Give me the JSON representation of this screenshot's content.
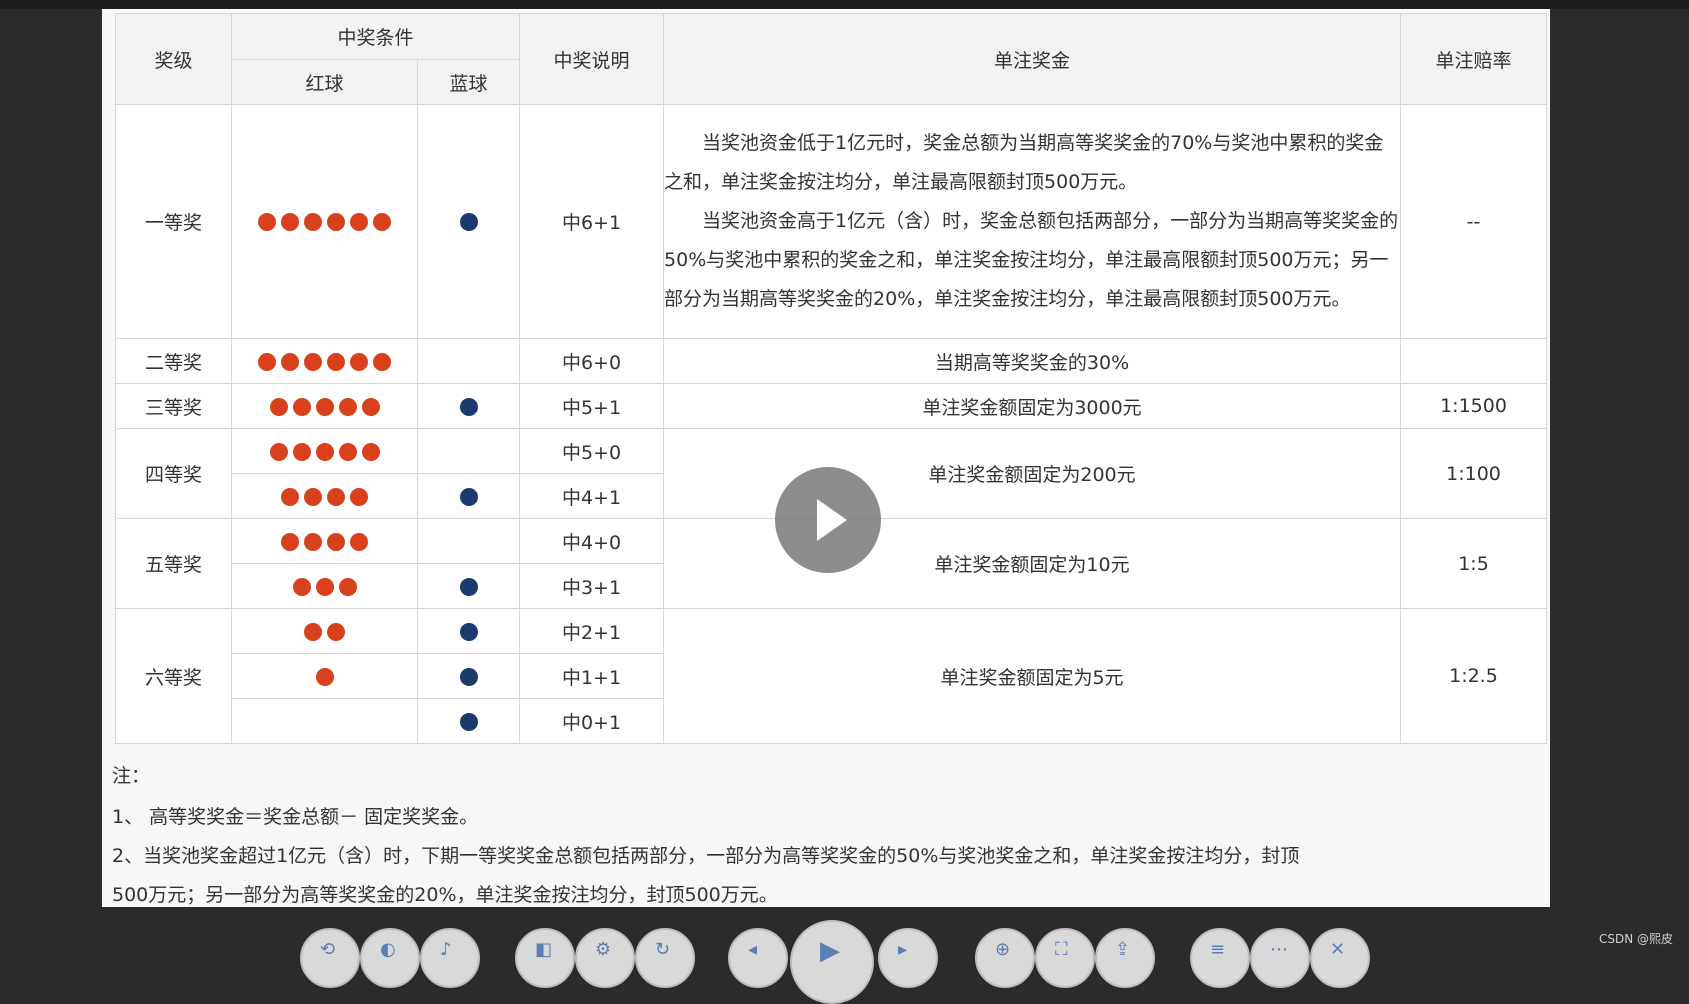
{
  "table": {
    "headers": {
      "level": "奖级",
      "condition": "中奖条件",
      "red": "红球",
      "blue": "蓝球",
      "explain": "中奖说明",
      "prize": "单注奖金",
      "odds": "单注赔率"
    },
    "rows": [
      {
        "level": "一等奖",
        "red_count": 6,
        "blue_count": 1,
        "explain": "中6+1",
        "prize_paragraphs": [
          "当奖池资金低于1亿元时，奖金总额为当期高等奖奖金的70%与奖池中累积的奖金之和，单注奖金按注均分，单注最高限额封顶500万元。",
          "当奖池资金高于1亿元（含）时，奖金总额包括两部分，一部分为当期高等奖奖金的50%与奖池中累积的奖金之和，单注奖金按注均分，单注最高限额封顶500万元；另一部分为当期高等奖奖金的20%，单注奖金按注均分，单注最高限额封顶500万元。"
        ],
        "odds": "--"
      },
      {
        "level": "二等奖",
        "red_count": 6,
        "blue_count": 0,
        "explain": "中6+0",
        "prize": "当期高等奖奖金的30%",
        "odds": ""
      },
      {
        "level": "三等奖",
        "red_count": 5,
        "blue_count": 1,
        "explain": "中5+1",
        "prize": "单注奖金额固定为3000元",
        "odds": "1:1500"
      },
      {
        "level": "四等奖",
        "sub": [
          {
            "red_count": 5,
            "blue_count": 0,
            "explain": "中5+0"
          },
          {
            "red_count": 4,
            "blue_count": 1,
            "explain": "中4+1"
          }
        ],
        "prize": "单注奖金额固定为200元",
        "odds": "1:100"
      },
      {
        "level": "五等奖",
        "sub": [
          {
            "red_count": 4,
            "blue_count": 0,
            "explain": "中4+0"
          },
          {
            "red_count": 3,
            "blue_count": 1,
            "explain": "中3+1"
          }
        ],
        "prize": "单注奖金额固定为10元",
        "odds": "1:5"
      },
      {
        "level": "六等奖",
        "sub": [
          {
            "red_count": 2,
            "blue_count": 1,
            "explain": "中2+1"
          },
          {
            "red_count": 1,
            "blue_count": 1,
            "explain": "中1+1"
          },
          {
            "red_count": 0,
            "blue_count": 1,
            "explain": "中0+1"
          }
        ],
        "prize": "单注奖金额固定为5元",
        "odds": "1:2.5"
      }
    ]
  },
  "notes": {
    "heading": "注：",
    "lines": [
      "1、 高等奖奖金＝奖金总额－ 固定奖奖金。",
      "2、当奖池奖金超过1亿元（含）时，下期一等奖奖金总额包括两部分，一部分为高等奖奖金的50%与奖池奖金之和，单注奖金按注均分，封顶",
      "500万元；另一部分为高等奖奖金的20%，单注奖金按注均分，封顶500万元。"
    ]
  },
  "colors": {
    "red_ball": "#d8411c",
    "blue_ball": "#1a3b6e"
  },
  "player": {
    "play_icon": "play-icon",
    "controls": [
      "rewind-icon",
      "prev-icon",
      "volume-icon",
      "skip-back-icon",
      "settings-icon",
      "loop-icon",
      "step-back-icon",
      "play-icon",
      "step-forward-icon",
      "zoom-icon",
      "fullscreen-icon",
      "share-icon",
      "menu-icon",
      "more-icon",
      "close-icon"
    ]
  },
  "watermark": "CSDN @熙皮"
}
